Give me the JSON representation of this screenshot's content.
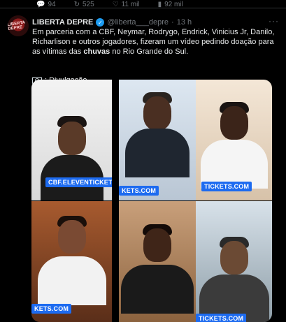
{
  "stats": {
    "replies": "94",
    "reposts": "525",
    "likes": "11 mil",
    "views": "92 mil"
  },
  "tweet": {
    "name": "LIBERTA DEPRE",
    "handle": "@liberta___depre",
    "time": "13 h",
    "avatar_text": "LIBERTA DEPRE",
    "text_part1": "Em parceria com a CBF, Neymar, Rodrygo, Endrick, Vinicius Jr, Danilo, Richarlison e outros jogadores, fizeram um vídeo pedindo doação para as vítimas das ",
    "text_bold": "chuvas",
    "text_part2": " no Rio Grande do Sul.",
    "caption": ": Divulgação"
  },
  "media": {
    "overlays": {
      "c1": "CBF.ELEVENTICKETS.COM",
      "c2": "KETS.COM",
      "c3": "TICKETS.COM",
      "c4": "KETS.COM",
      "c6": "TICKETS.COM"
    }
  },
  "colors": {
    "background": "#000000",
    "text": "#e7e9ea",
    "muted": "#71767b",
    "verified": "#1d9bf0",
    "ticker": "#1d6bf0"
  }
}
